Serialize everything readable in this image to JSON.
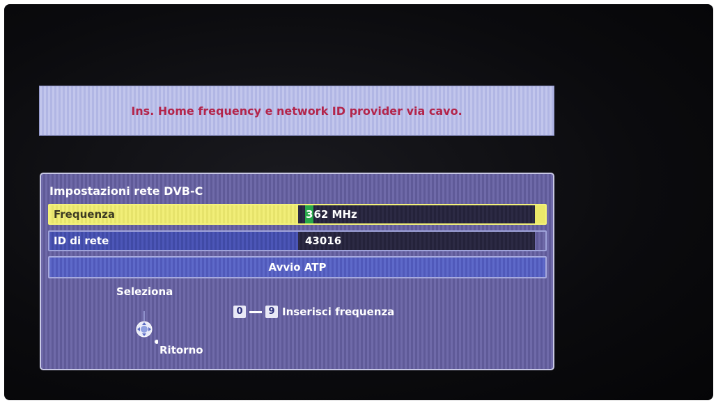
{
  "banner": {
    "message": "Ins. Home frequency e network ID provider via cavo."
  },
  "panel": {
    "title": "Impostazioni rete DVB-C",
    "rows": [
      {
        "label": "Frequenza",
        "value_cursor_digit": "3",
        "value_rest": "62 MHz",
        "selected": true
      },
      {
        "label": "ID di rete",
        "value": "43016",
        "selected": false
      }
    ],
    "start_button": "Avvio ATP"
  },
  "help": {
    "select_label": "Seleziona",
    "return_label": "Ritorno",
    "key_from": "0",
    "key_to": "9",
    "key_action": "Inserisci frequenza"
  },
  "colors": {
    "banner_text": "#b3244a",
    "selected_row": "#ebe86a",
    "cursor": "#28a84a"
  }
}
